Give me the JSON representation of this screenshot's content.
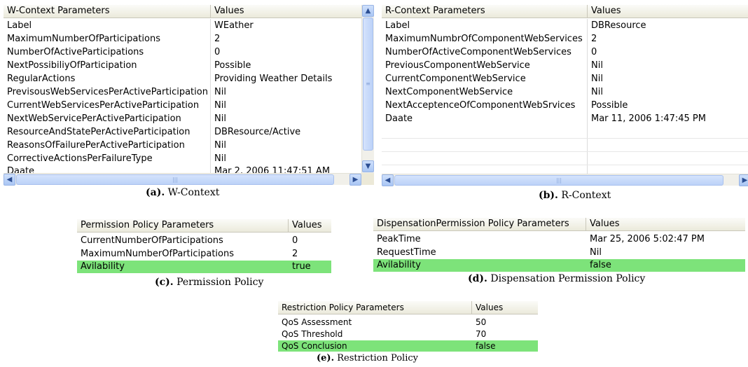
{
  "w_context": {
    "col1": "W-Context Parameters",
    "col2": "Values",
    "rows": [
      [
        "Label",
        "WEather"
      ],
      [
        "MaximumNumberOfParticipations",
        "2"
      ],
      [
        "NumberOfActiveParticipations",
        "0"
      ],
      [
        "NextPossibiliyOfParticipation",
        "Possible"
      ],
      [
        "RegularActions",
        "Providing Weather Details"
      ],
      [
        "PrevisousWebServicesPerActiveParticipation",
        "Nil"
      ],
      [
        "CurrentWebServicesPerActiveParticipation",
        "Nil"
      ],
      [
        "NextWebServicePerActiveParticipation",
        "Nil"
      ],
      [
        "ResourceAndStatePerActiveParticipation",
        "DBResource/Active"
      ],
      [
        "ReasonsOfFailurePerActiveParticipation",
        "Nil"
      ],
      [
        "CorrectiveActionsPerFailureType",
        "Nil"
      ],
      [
        "Daate",
        "Mar 2, 2006 11:47:51 AM"
      ]
    ],
    "caption_bold": "(a).",
    "caption_text": " W-Context"
  },
  "r_context": {
    "col1": "R-Context Parameters",
    "col2": "Values",
    "rows": [
      [
        "Label",
        "DBResource"
      ],
      [
        "MaximumNumbrOfComponentWebServices",
        "2"
      ],
      [
        "NumberOfActiveComponentWebServices",
        "0"
      ],
      [
        "PreviousComponentWebService",
        "Nil"
      ],
      [
        "CurrentComponentWebService",
        "Nil"
      ],
      [
        "NextComponentWebService",
        "Nil"
      ],
      [
        "NextAcceptenceOfComponentWebSrvices",
        "Possible"
      ],
      [
        "Daate",
        "Mar 11, 2006 1:47:45 PM"
      ]
    ],
    "caption_bold": "(b).",
    "caption_text": " R-Context"
  },
  "permission": {
    "col1": "Permission Policy Parameters",
    "col2": "Values",
    "rows": [
      [
        "CurrentNumberOfParticipations",
        "0"
      ],
      [
        "MaximumNumberOfParticipations",
        "2"
      ],
      [
        "Avilability",
        "true"
      ]
    ],
    "caption_bold": "(c).",
    "caption_text": " Permission Policy"
  },
  "dispensation": {
    "col1": "DispensationPermission Policy Parameters",
    "col2": "Values",
    "rows": [
      [
        "PeakTime",
        "Mar 25, 2006 5:02:47 PM"
      ],
      [
        "RequestTime",
        "Nil"
      ],
      [
        "Avilability",
        "false"
      ]
    ],
    "caption_bold": "(d).",
    "caption_text": " Dispensation Permission Policy"
  },
  "restriction": {
    "col1": "Restriction Policy Parameters",
    "col2": "Values",
    "rows": [
      [
        "QoS Assessment",
        "50"
      ],
      [
        "QoS Threshold",
        "70"
      ],
      [
        "QoS Conclusion",
        "false"
      ]
    ],
    "caption_bold": "(e).",
    "caption_text": " Restriction Policy"
  },
  "colors": {
    "highlight": "#7de37a",
    "header": "#ebeadb"
  },
  "icons": {
    "scroll_up": "chevron-up-icon",
    "scroll_down": "chevron-down-icon",
    "scroll_left": "chevron-left-icon",
    "scroll_right": "chevron-right-icon"
  }
}
